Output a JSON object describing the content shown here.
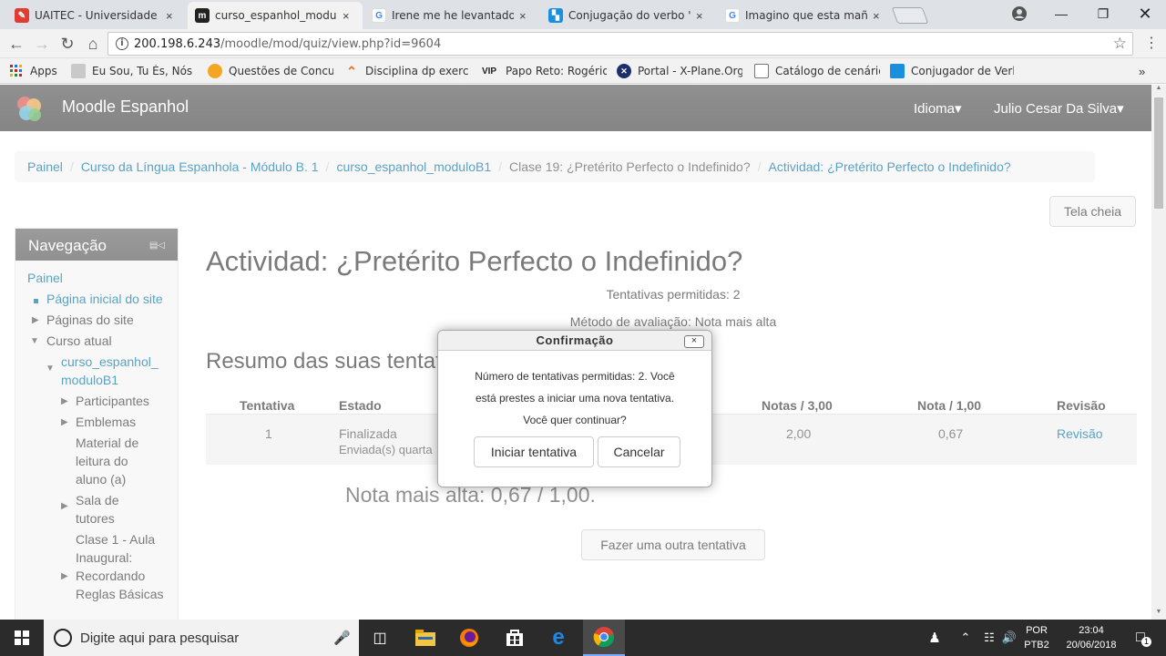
{
  "browser": {
    "tabs": [
      {
        "label": "UAITEC - Universidade Ab",
        "icon": "pencil-favicon",
        "color": "#e03c31"
      },
      {
        "label": "curso_espanhol_moduloB",
        "icon": "moodle-favicon",
        "color": "#222222"
      },
      {
        "label": "Irene me he levantado ej",
        "icon": "google-favicon",
        "color": "#4285f4"
      },
      {
        "label": "Conjugação do verbo \"fu",
        "icon": "conjugacao-favicon",
        "color": "#1a8fdd"
      },
      {
        "label": "Imagino que esta mañana",
        "icon": "google-favicon",
        "color": "#4285f4"
      }
    ],
    "tab_close_glyph": "×",
    "url_host": "200.198.6.243",
    "url_path": "/moodle/mod/quiz/view.php?id=9604",
    "bookmarks": [
      {
        "label": "Apps",
        "icon": "apps-grid-icon"
      },
      {
        "label": "Eu Sou, Tu És, Nós S",
        "icon": "bookmark-favicon"
      },
      {
        "label": "Questões de Concur",
        "icon": "bookmark-favicon"
      },
      {
        "label": "Disciplina dp exercic",
        "icon": "bookmark-favicon"
      },
      {
        "label": "Papo Reto: Rogério F",
        "icon": "vip-favicon",
        "short": "VIP"
      },
      {
        "label": "Portal - X-Plane.Org",
        "icon": "xplane-favicon"
      },
      {
        "label": "Catálogo de cenário",
        "icon": "page-icon"
      },
      {
        "label": "Conjugador de Verb",
        "icon": "conjugador-favicon"
      }
    ]
  },
  "site": {
    "brand": "Moodle Espanhol",
    "nav_language": "Idioma",
    "nav_user": "Julio Cesar Da Silva",
    "caret": "▾"
  },
  "breadcrumb": [
    "Painel",
    "Curso da Língua Espanhola - Módulo B. 1",
    "curso_espanhol_moduloB1",
    "Clase 19: ¿Pretérito Perfecto o Indefinido?",
    "Actividad: ¿Pretérito Perfecto o Indefinido?"
  ],
  "fullscreen_button": "Tela cheia",
  "navigation": {
    "title": "Navegação",
    "items": [
      {
        "label": "Painel"
      },
      {
        "label": "Página inicial do site"
      },
      {
        "label": "Páginas do site"
      },
      {
        "label": "Curso atual"
      },
      {
        "label": "curso_espanhol_ moduloB1"
      },
      {
        "label": "Participantes"
      },
      {
        "label": "Emblemas"
      },
      {
        "label": "Material de leitura do aluno (a)"
      },
      {
        "label": "Sala de tutores"
      },
      {
        "label": "Clase 1 - Aula Inaugural:"
      },
      {
        "label": "Recordando Reglas Básicas"
      }
    ]
  },
  "main": {
    "title": "Actividad: ¿Pretérito Perfecto o Indefinido?",
    "attempts_allowed": "Tentativas permitidas: 2",
    "grading_method": "Método de avaliação: Nota mais alta",
    "summary_title": "Resumo das suas tentativas",
    "table": {
      "headers": [
        "Tentativa",
        "Estado",
        "Notas / 3,00",
        "Nota / 1,00",
        "Revisão"
      ],
      "rows": [
        {
          "attempt": "1",
          "state": "Finalizada",
          "state_detail": "Enviada(s) quarta",
          "marks": "2,00",
          "grade": "0,67",
          "review": "Revisão"
        }
      ]
    },
    "best_grade": "Nota mais alta: 0,67 / 1,00.",
    "reattempt_button": "Fazer uma outra tentativa"
  },
  "dialog": {
    "title": "Confirmação",
    "close_glyph": "×",
    "line1": "Número de tentativas permitidas: 2. Você",
    "line2": "está prestes a iniciar uma nova tentativa.",
    "line3": "Você quer continuar?",
    "start_button": "Iniciar tentativa",
    "cancel_button": "Cancelar"
  },
  "taskbar": {
    "search_placeholder": "Digite aqui para pesquisar",
    "language_top": "POR",
    "language_bottom": "PTB2",
    "time": "23:04",
    "date": "20/06/2018",
    "notification_count": "1"
  },
  "colors": {
    "link": "#0070a8",
    "navbar": "#4d4d4d",
    "taskbar": "#2b2b2b"
  }
}
